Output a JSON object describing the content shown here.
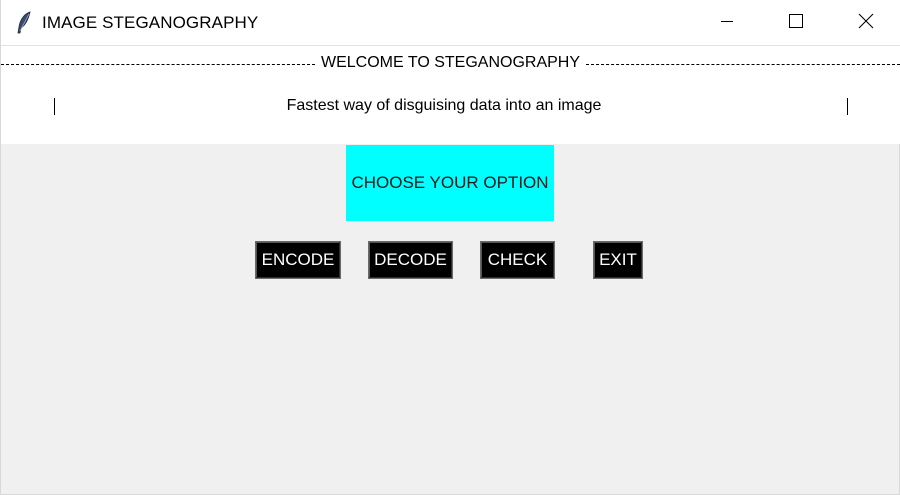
{
  "window": {
    "title": "IMAGE STEGANOGRAPHY",
    "app_icon": "feather-icon",
    "controls": {
      "minimize_icon": "minimize-icon",
      "maximize_icon": "maximize-icon",
      "close_icon": "close-icon"
    }
  },
  "header": {
    "welcome": "WELCOME TO STEGANOGRAPHY",
    "tagline": "Fastest way of disguising data into an image",
    "left_bar": "|",
    "right_bar": "|"
  },
  "main": {
    "choose_label": "CHOOSE YOUR OPTION",
    "buttons": {
      "encode": "ENCODE",
      "decode": "DECODE",
      "check": "CHECK",
      "exit": "EXIT"
    }
  },
  "colors": {
    "accent_box": "#00ffff",
    "button_bg": "#000000",
    "button_text": "#ffffff",
    "content_bg": "#f0f0f0",
    "header_bg": "#ffffff"
  }
}
